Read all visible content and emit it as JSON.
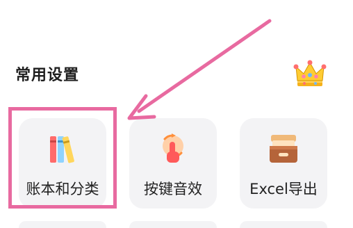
{
  "section": {
    "title": "常用设置"
  },
  "colors": {
    "highlight": "#e86aa0",
    "tile_background": "#f3f3f5"
  },
  "tiles": [
    {
      "label": "账本和分类",
      "icon": "books-icon"
    },
    {
      "label": "按键音效",
      "icon": "tap-sound-icon"
    },
    {
      "label": "Excel导出",
      "icon": "archive-box-icon"
    }
  ],
  "badge": {
    "icon": "crown-icon"
  }
}
